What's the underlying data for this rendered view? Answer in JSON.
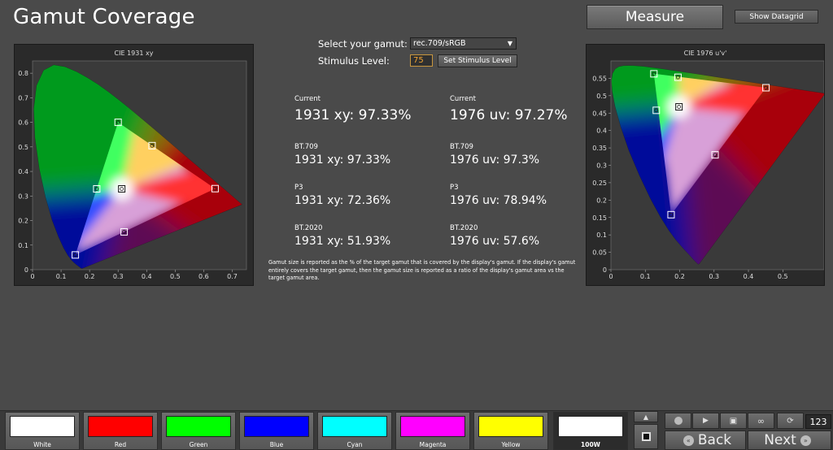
{
  "header": {
    "title": "Gamut Coverage",
    "measure_label": "Measure",
    "datagrid_label": "Show Datagrid"
  },
  "controls": {
    "gamut_label": "Select your gamut:",
    "gamut_value": "rec.709/sRGB",
    "stimulus_label": "Stimulus Level:",
    "stimulus_value": "75",
    "set_stimulus_label": "Set Stimulus Level"
  },
  "stats": [
    {
      "caption": "Current",
      "xy": "1931 xy: 97.33%",
      "uv_caption": "Current",
      "uv": "1976 uv: 97.27%"
    },
    {
      "caption": "BT.709",
      "xy": "1931 xy: 97.33%",
      "uv_caption": "BT.709",
      "uv": "1976 uv: 97.3%"
    },
    {
      "caption": "P3",
      "xy": "1931 xy: 72.36%",
      "uv_caption": "P3",
      "uv": "1976 uv: 78.94%"
    },
    {
      "caption": "BT.2020",
      "xy": "1931 xy: 51.93%",
      "uv_caption": "BT.2020",
      "uv": "1976 uv: 57.6%"
    }
  ],
  "note": "Gamut size is reported as the % of the target gamut that is covered by the display's gamut. If the display's gamut entirely covers the target gamut, then the gamut size is reported as a ratio of the display's gamut area vs the target gamut area.",
  "swatches": [
    {
      "label": "White",
      "color": "#ffffff"
    },
    {
      "label": "Red",
      "color": "#ff0000"
    },
    {
      "label": "Green",
      "color": "#00ff00"
    },
    {
      "label": "Blue",
      "color": "#0000ff"
    },
    {
      "label": "Cyan",
      "color": "#00ffff"
    },
    {
      "label": "Magenta",
      "color": "#ff00ff"
    },
    {
      "label": "Yellow",
      "color": "#ffff00"
    },
    {
      "label": "100W",
      "color": "#ffffff"
    }
  ],
  "nav": {
    "back_label": "Back",
    "next_label": "Next",
    "counter": "123",
    "icons": [
      "up-arrow-icon",
      "stop-icon",
      "stop-small-icon",
      "play-icon",
      "save-icon",
      "loop-icon",
      "refresh-icon",
      "rewind-icon",
      "forward-icon"
    ]
  },
  "chart_data": [
    {
      "type": "scatter",
      "title": "CIE 1931 xy",
      "xlim": [
        0,
        0.75
      ],
      "ylim": [
        0,
        0.85
      ],
      "xticks": [
        0,
        0.1,
        0.2,
        0.3,
        0.4,
        0.5,
        0.6,
        0.7
      ],
      "yticks": [
        0,
        0.1,
        0.2,
        0.3,
        0.4,
        0.5,
        0.6,
        0.7,
        0.8
      ],
      "target_gamut": [
        [
          0.64,
          0.33
        ],
        [
          0.3,
          0.6
        ],
        [
          0.15,
          0.06
        ]
      ],
      "target_points": [
        {
          "name": "Red",
          "x": 0.64,
          "y": 0.33
        },
        {
          "name": "Green",
          "x": 0.3,
          "y": 0.6
        },
        {
          "name": "Blue",
          "x": 0.15,
          "y": 0.06
        },
        {
          "name": "Cyan",
          "x": 0.225,
          "y": 0.329
        },
        {
          "name": "Magenta",
          "x": 0.321,
          "y": 0.154
        },
        {
          "name": "Yellow",
          "x": 0.419,
          "y": 0.505
        },
        {
          "name": "White",
          "x": 0.3127,
          "y": 0.329
        }
      ]
    },
    {
      "type": "scatter",
      "title": "CIE 1976 u'v'",
      "xlim": [
        0,
        0.62
      ],
      "ylim": [
        0,
        0.6
      ],
      "xticks": [
        0,
        0.1,
        0.2,
        0.3,
        0.4,
        0.5
      ],
      "yticks": [
        0,
        0.05,
        0.1,
        0.15,
        0.2,
        0.25,
        0.3,
        0.35,
        0.4,
        0.45,
        0.5,
        0.55
      ],
      "target_gamut": [
        [
          0.451,
          0.523
        ],
        [
          0.125,
          0.563
        ],
        [
          0.175,
          0.158
        ]
      ],
      "target_points": [
        {
          "name": "Red",
          "x": 0.451,
          "y": 0.523
        },
        {
          "name": "Green",
          "x": 0.125,
          "y": 0.563
        },
        {
          "name": "Blue",
          "x": 0.175,
          "y": 0.158
        },
        {
          "name": "Cyan",
          "x": 0.132,
          "y": 0.458
        },
        {
          "name": "Magenta",
          "x": 0.303,
          "y": 0.33
        },
        {
          "name": "Yellow",
          "x": 0.195,
          "y": 0.553
        },
        {
          "name": "White",
          "x": 0.198,
          "y": 0.468
        }
      ]
    }
  ]
}
